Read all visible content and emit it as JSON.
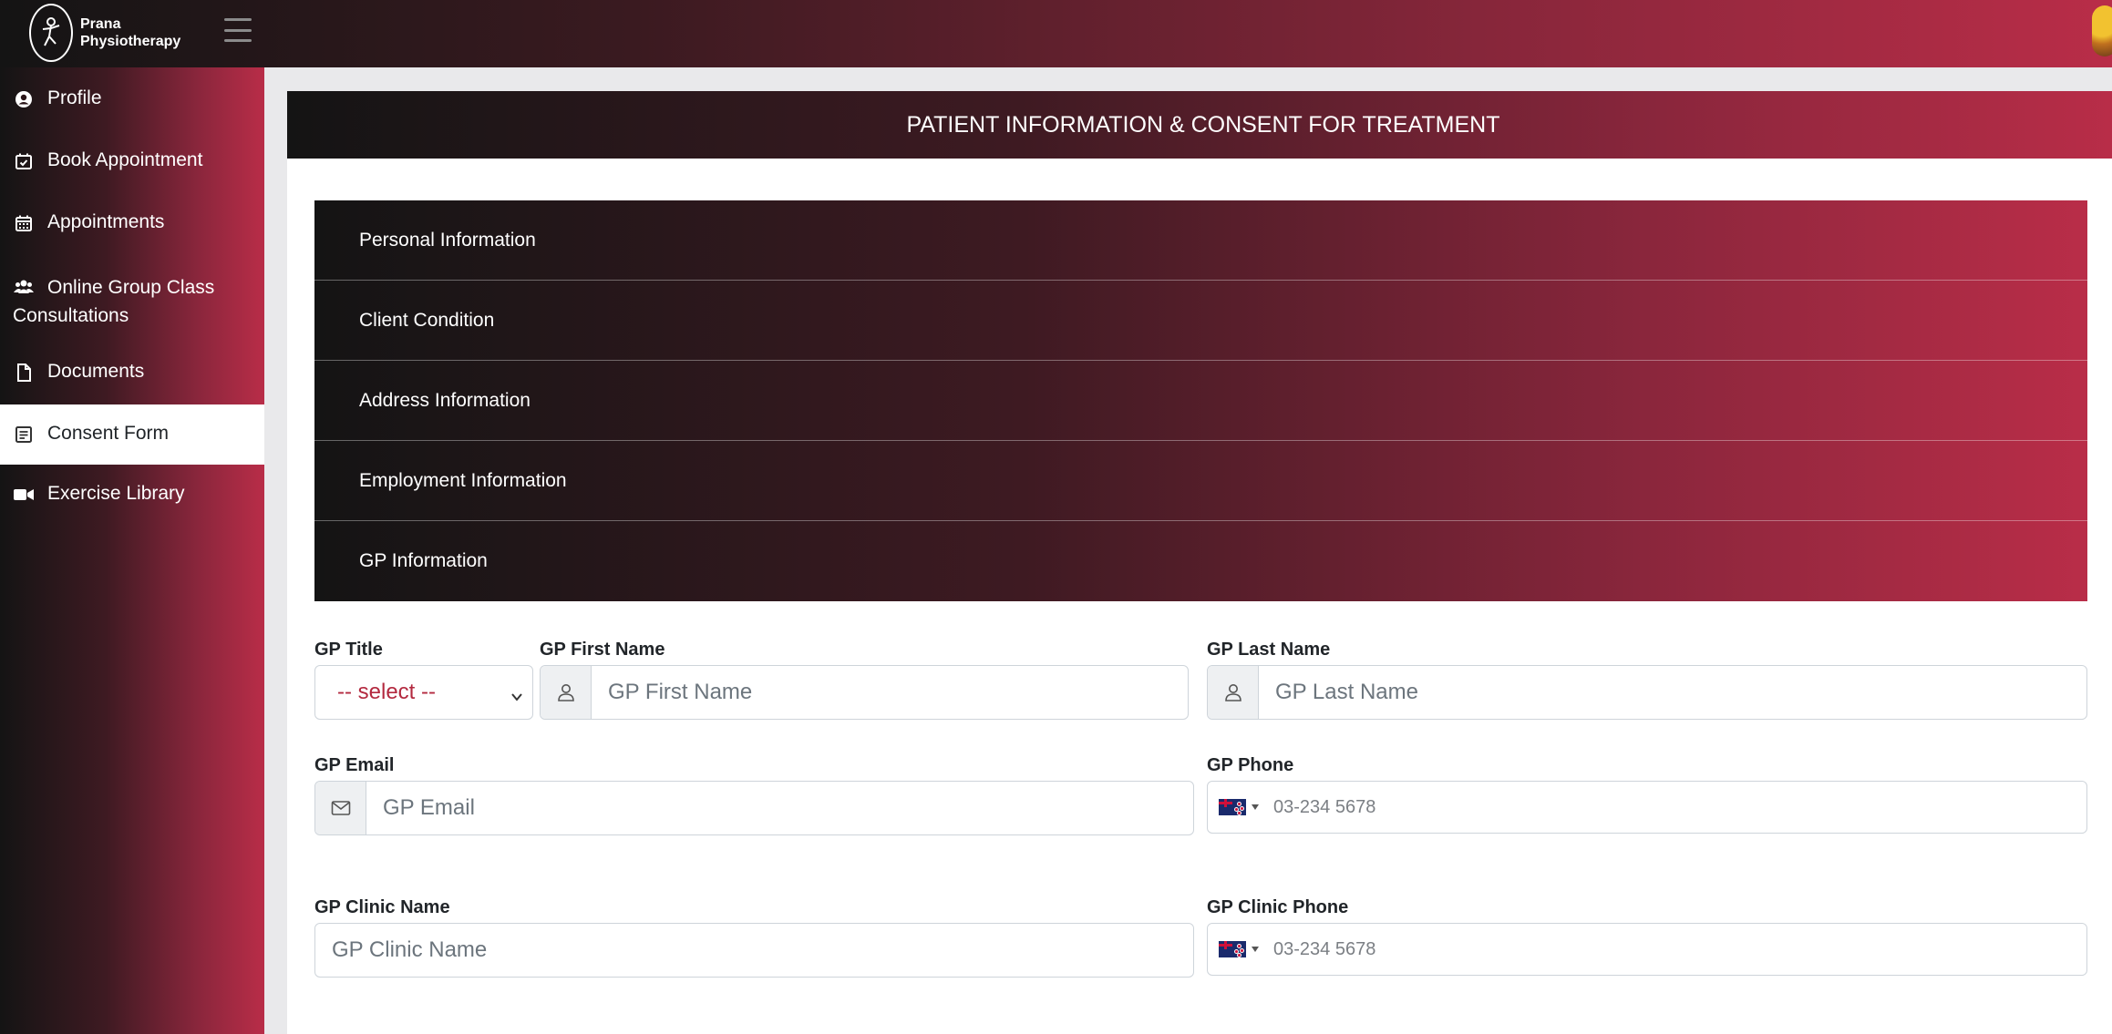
{
  "brand": {
    "line1": "Prana",
    "line2": "Physiotherapy"
  },
  "sidebar": {
    "items": [
      {
        "label": "Profile",
        "icon": "user-circle-icon"
      },
      {
        "label": "Book Appointment",
        "icon": "calendar-check-icon"
      },
      {
        "label": "Appointments",
        "icon": "calendar-icon"
      },
      {
        "label": "Online Group Class Consultations",
        "icon": "users-icon"
      },
      {
        "label": "Documents",
        "icon": "file-icon"
      },
      {
        "label": "Consent Form",
        "icon": "form-icon",
        "active": true
      },
      {
        "label": "Exercise Library",
        "icon": "video-icon"
      }
    ]
  },
  "page": {
    "title": "PATIENT INFORMATION & CONSENT FOR TREATMENT"
  },
  "accordion": {
    "sections": [
      {
        "label": "Personal Information"
      },
      {
        "label": "Client Condition"
      },
      {
        "label": "Address Information"
      },
      {
        "label": "Employment Information"
      },
      {
        "label": "GP Information"
      }
    ]
  },
  "form": {
    "gp_title": {
      "label": "GP Title",
      "value": "-- select --"
    },
    "gp_first_name": {
      "label": "GP First Name",
      "placeholder": "GP First Name"
    },
    "gp_last_name": {
      "label": "GP Last Name",
      "placeholder": "GP Last Name"
    },
    "gp_email": {
      "label": "GP Email",
      "placeholder": "GP Email"
    },
    "gp_phone": {
      "label": "GP Phone",
      "placeholder": "03-234 5678",
      "flag": "NZ"
    },
    "gp_clinic_name": {
      "label": "GP Clinic Name",
      "placeholder": "GP Clinic Name"
    },
    "gp_clinic_phone": {
      "label": "GP Clinic Phone",
      "placeholder": "03-234 5678",
      "flag": "NZ"
    }
  },
  "colors": {
    "accent": "#b92d48",
    "dark": "#141414",
    "select_text": "#b3293f"
  }
}
